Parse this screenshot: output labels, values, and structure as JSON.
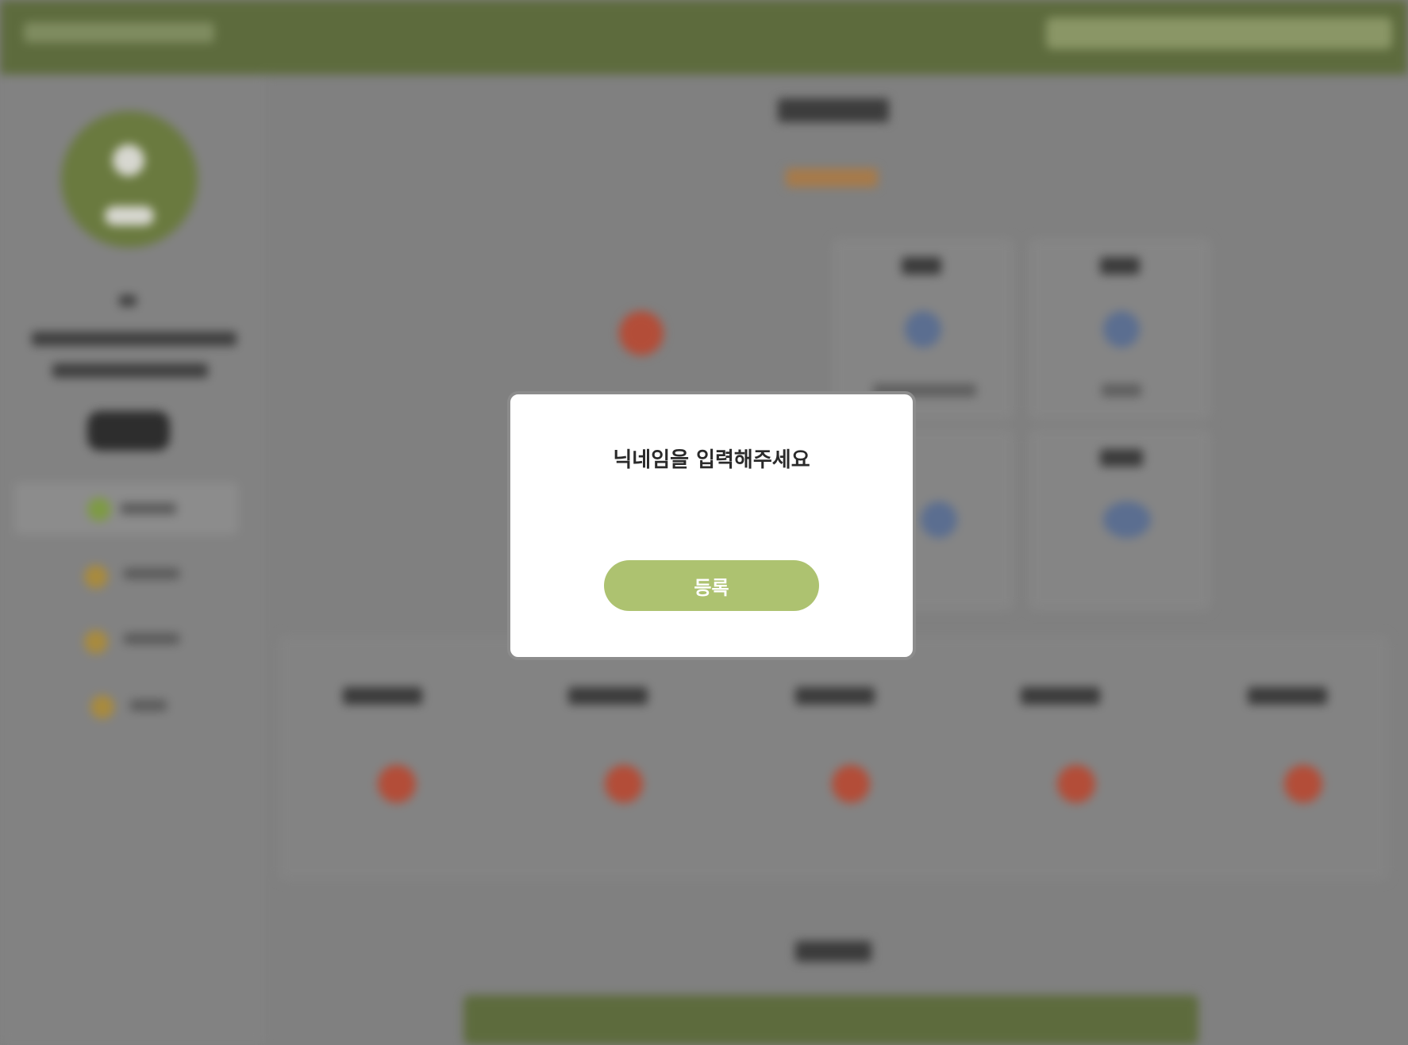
{
  "theme": {
    "header_green": "#5d6b3d",
    "accent_green": "#adc270",
    "overlay_gray": "#808080",
    "modal_bg": "#ffffff"
  },
  "modal": {
    "title": "닉네임을 입력해주세요",
    "nickname_value": "",
    "submit_label": "등록"
  }
}
